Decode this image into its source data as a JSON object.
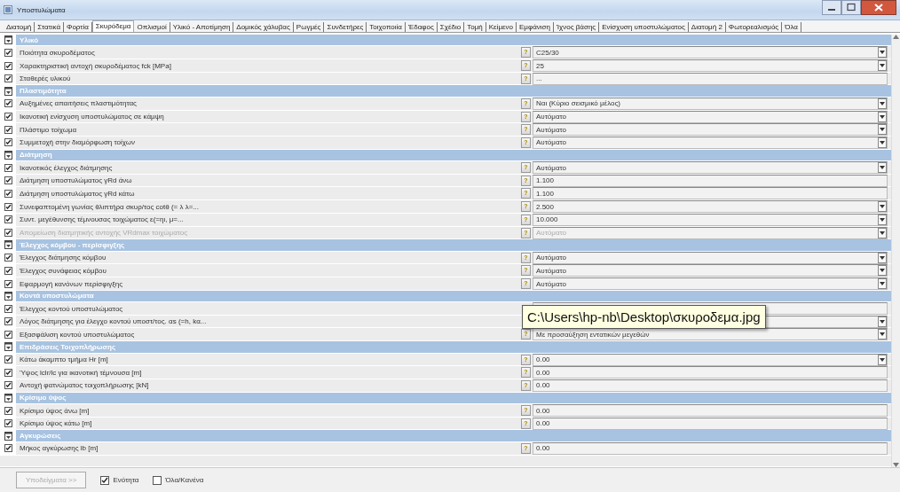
{
  "window": {
    "title": "Υποστυλώματα"
  },
  "tabs": [
    {
      "label": "Διατομή",
      "selected": false
    },
    {
      "label": "Στατικά",
      "selected": false
    },
    {
      "label": "Φορτία",
      "selected": false
    },
    {
      "label": "Σκυρόδεμα",
      "selected": true
    },
    {
      "label": "Οπλισμοί",
      "selected": false
    },
    {
      "label": "Υλικό - Αποτίμηση",
      "selected": false
    },
    {
      "label": "Δομικός χάλυβας",
      "selected": false
    },
    {
      "label": "Ρωγμές",
      "selected": false
    },
    {
      "label": "Συνδετήρες",
      "selected": false
    },
    {
      "label": "Τοιχοποιία",
      "selected": false
    },
    {
      "label": "Έδαφος",
      "selected": false
    },
    {
      "label": "Σχέδιο",
      "selected": false
    },
    {
      "label": "Τομή",
      "selected": false
    },
    {
      "label": "Κείμενο",
      "selected": false
    },
    {
      "label": "Εμφάνιση",
      "selected": false
    },
    {
      "label": "Ίχνος βάσης",
      "selected": false
    },
    {
      "label": "Ενίσχυση υποστυλώματος",
      "selected": false
    },
    {
      "label": "Διατομή 2",
      "selected": false
    },
    {
      "label": "Φωτορεαλισμός",
      "selected": false
    },
    {
      "label": "Όλα",
      "selected": false
    }
  ],
  "groups": [
    {
      "title": "Υλικό",
      "items": [
        {
          "label": "Ποιότητα σκυροδέματος",
          "checked": true,
          "help": "?",
          "value": "C25/30",
          "dropdown": true,
          "disabled": false
        },
        {
          "label": "Χαρακτηριστική αντοχή σκυροδέματος fck [MPa]",
          "checked": true,
          "help": "?",
          "value": "25",
          "dropdown": true,
          "disabled": false
        },
        {
          "label": "Σταθερές υλικού",
          "checked": true,
          "help": "?",
          "value": "...",
          "dropdown": false,
          "disabled": false
        }
      ]
    },
    {
      "title": "Πλαστιμότητα",
      "items": [
        {
          "label": "Αυξημένες απαιτήσεις πλαστιμότητας",
          "checked": true,
          "help": "?",
          "value": "Ναι (Κύριο σεισμικό μέλος)",
          "dropdown": true,
          "disabled": false
        },
        {
          "label": "Ικανοτική ενίσχυση υποστυλώματος σε κάμψη",
          "checked": true,
          "help": "?",
          "value": "Αυτόματο",
          "dropdown": true,
          "disabled": false
        },
        {
          "label": "Πλάστιμο τοίχωμα",
          "checked": true,
          "help": "?",
          "value": "Αυτόματο",
          "dropdown": true,
          "disabled": false
        },
        {
          "label": "Συμμετοχή στην διαμόρφωση τοίχων",
          "checked": true,
          "help": "?",
          "value": "Αυτόματο",
          "dropdown": true,
          "disabled": false
        }
      ]
    },
    {
      "title": "Διάτμηση",
      "items": [
        {
          "label": "Ικανοτικός έλεγχος διάτμησης",
          "checked": true,
          "help": "?",
          "value": "Αυτόματο",
          "dropdown": true,
          "disabled": false
        },
        {
          "label": "Διάτμηση υποστυλώματος γRd άνω",
          "checked": true,
          "help": "?",
          "value": "1.100",
          "dropdown": false,
          "disabled": false
        },
        {
          "label": "Διάτμηση υποστυλώματος γRd κάτω",
          "checked": true,
          "help": "?",
          "value": "1.100",
          "dropdown": false,
          "disabled": false
        },
        {
          "label": "Συνεφαπτομένη γωνίας θλιπτήρα σκυρ/τος cotθ (= λ λ=...",
          "checked": true,
          "help": "?",
          "value": "2.500",
          "dropdown": true,
          "disabled": false
        },
        {
          "label": "Συντ. μεγέθυνσης τέμνουσας τοιχώματος ε(=ηι, μ=...",
          "checked": true,
          "help": "?",
          "value": "10.000",
          "dropdown": true,
          "disabled": false
        },
        {
          "label": "Απομείωση διατμητικής αντοχής VRdmax τοιχώματος",
          "checked": true,
          "help": "?",
          "value": "Αυτόματο",
          "dropdown": true,
          "disabled": true
        }
      ]
    },
    {
      "title": "Έλεγχος κόμβου - περίσφιγξης",
      "items": [
        {
          "label": "Έλεγχος διάτμησης κόμβου",
          "checked": true,
          "help": "?",
          "value": "Αυτόματο",
          "dropdown": true,
          "disabled": false
        },
        {
          "label": "Έλεγχος συνάφειας κόμβου",
          "checked": true,
          "help": "?",
          "value": "Αυτόματο",
          "dropdown": true,
          "disabled": false
        },
        {
          "label": "Εφαρμογή κανόνων περίσφιγξης",
          "checked": true,
          "help": "?",
          "value": "Αυτόματο",
          "dropdown": true,
          "disabled": false
        }
      ]
    },
    {
      "title": "Κοντά υποστυλώματα",
      "items": [
        {
          "label": "Έλεγχος κοντού υποστυλώματος",
          "checked": true,
          "dropdown": false,
          "disabled": false
        },
        {
          "label": "Λόγος διάτμησης για έλεγχο κοντού υποστ/τος. αs (=h, kα...",
          "checked": true,
          "dropdown": true,
          "disabled": false
        },
        {
          "label": "Εξασφάλιση κοντού υποστυλώματος",
          "checked": true,
          "help": "?",
          "value": "Με προσαύξηση εντατικών μεγεθών",
          "dropdown": true,
          "disabled": false
        }
      ]
    },
    {
      "title": "Επιδράσεις Τοιχοπλήρωσης",
      "items": [
        {
          "label": "Κάτω άκαμπτο τμήμα Hr [m]",
          "checked": true,
          "help": "?",
          "value": "0.00",
          "dropdown": true,
          "disabled": false
        },
        {
          "label": "Ύψος lclr/lc για ικανοτική τέμνουσα [m]",
          "checked": true,
          "help": "?",
          "value": "0.00",
          "dropdown": false,
          "disabled": false
        },
        {
          "label": "Αντοχή φατνώματος τοιχοπλήρωσης [kN]",
          "checked": true,
          "help": "?",
          "value": "0.00",
          "dropdown": false,
          "disabled": false
        }
      ]
    },
    {
      "title": "Κρίσιμο ύψος",
      "items": [
        {
          "label": "Κρίσιμο ύψος άνω [m]",
          "checked": true,
          "help": "?",
          "value": "0.00",
          "dropdown": false,
          "disabled": false
        },
        {
          "label": "Κρίσιμο ύψος κάτω [m]",
          "checked": true,
          "help": "?",
          "value": "0.00",
          "dropdown": false,
          "disabled": false
        }
      ]
    },
    {
      "title": "Αγκυρώσεις",
      "items": [
        {
          "label": "Μήκος αγκύρωσης lb [m]",
          "checked": true,
          "help": "?",
          "value": "0.00",
          "dropdown": false,
          "disabled": false
        }
      ]
    }
  ],
  "tooltip": {
    "text": "C:\\Users\\hp-nb\\Desktop\\σκυροδεμα.jpg"
  },
  "footer": {
    "button": {
      "label": "Υποδείγματα >>",
      "disabled": true
    },
    "checkboxes": [
      {
        "label": "Ενότητα",
        "checked": true
      },
      {
        "label": "Όλα/Κανένα",
        "checked": false
      }
    ]
  }
}
